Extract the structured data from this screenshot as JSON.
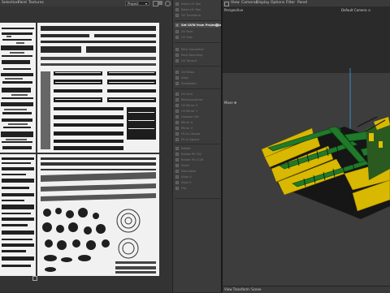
{
  "uv_editor": {
    "menu": [
      "Selection",
      "Paint",
      "Textures"
    ],
    "dropdown_value": "Project",
    "icons": [
      "grid-icon",
      "layers-icon",
      "circle-icon",
      "settings-icon"
    ]
  },
  "tool_panel": {
    "items": [
      {
        "label": "Relax UV Tool",
        "active": false
      },
      {
        "label": "Relax UV Tool",
        "active": false
      },
      {
        "label": "UV Transform",
        "active": false
      },
      {
        "label": "Set UVW from Projection",
        "active": true
      },
      {
        "label": "UV Pack",
        "active": false
      },
      {
        "label": "UV Sew",
        "active": false
      },
      {
        "label": "Pack Geometric",
        "active": false
      },
      {
        "label": "Pack Bounding",
        "active": false
      },
      {
        "label": "UV Terrace",
        "active": false
      },
      {
        "label": "UV Relax",
        "active": false
      },
      {
        "label": "Align",
        "active": false
      },
      {
        "label": "Straighten",
        "active": false
      },
      {
        "label": "UV Grid",
        "active": false
      },
      {
        "label": "Rectangularize",
        "active": false
      },
      {
        "label": "UV Mirror X",
        "active": false
      },
      {
        "label": "UV Mirror Y",
        "active": false
      },
      {
        "label": "Unwrap UVs",
        "active": false
      },
      {
        "label": "Mirror U",
        "active": false
      },
      {
        "label": "Mirror V",
        "active": false
      },
      {
        "label": "Fit to Canvas",
        "active": false
      },
      {
        "label": "Fit to Aspect",
        "active": false
      },
      {
        "label": "Rotate",
        "active": false
      },
      {
        "label": "Rotate 90 CW",
        "active": false
      },
      {
        "label": "Rotate 90 CCW",
        "active": false
      },
      {
        "label": "Scale",
        "active": false
      },
      {
        "label": "Normalize",
        "active": false
      },
      {
        "label": "Align U",
        "active": false
      },
      {
        "label": "Align V",
        "active": false
      },
      {
        "label": "Flip",
        "active": false
      }
    ]
  },
  "viewport": {
    "menu": [
      "View",
      "Cameras",
      "Display",
      "Options",
      "Filter",
      "Panel"
    ],
    "label_perspective": "Perspective",
    "label_camera": "Default Camera",
    "label_move": "Move",
    "bottom_status": "View Transform: Scene"
  },
  "colors": {
    "model_yellow": "#e0c000",
    "model_green": "#1f7a2a",
    "model_dark": "#1b1b1b",
    "active_text": "#f2f2f2"
  }
}
